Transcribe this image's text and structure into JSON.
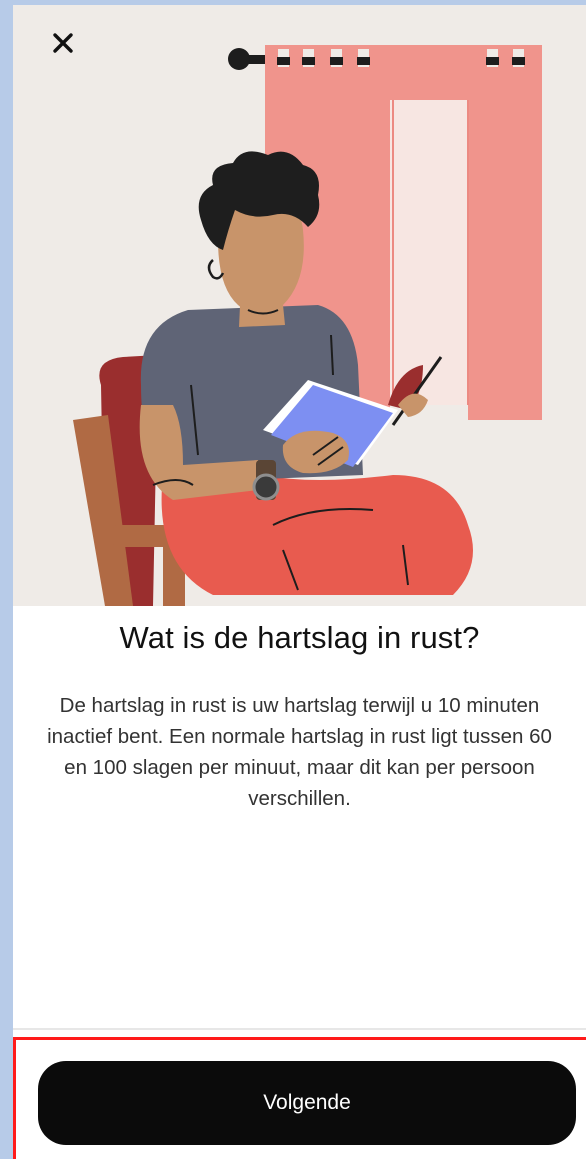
{
  "header": {
    "close_icon": "close-icon"
  },
  "illustration": {
    "description_icon": "person-reading-illustration"
  },
  "content": {
    "title": "Wat is de hartslag in rust?",
    "description": "De hartslag in rust is uw hartslag terwijl u 10 minuten inactief bent. Een normale hartslag in rust ligt tussen 60 en 100 slagen per minuut, maar dit kan per persoon verschillen."
  },
  "footer": {
    "next_label": "Volgende"
  },
  "colors": {
    "background": "#efebe7",
    "button": "#0b0b0b",
    "curtain": "#f0948c",
    "highlight": "#ff1a1a"
  }
}
